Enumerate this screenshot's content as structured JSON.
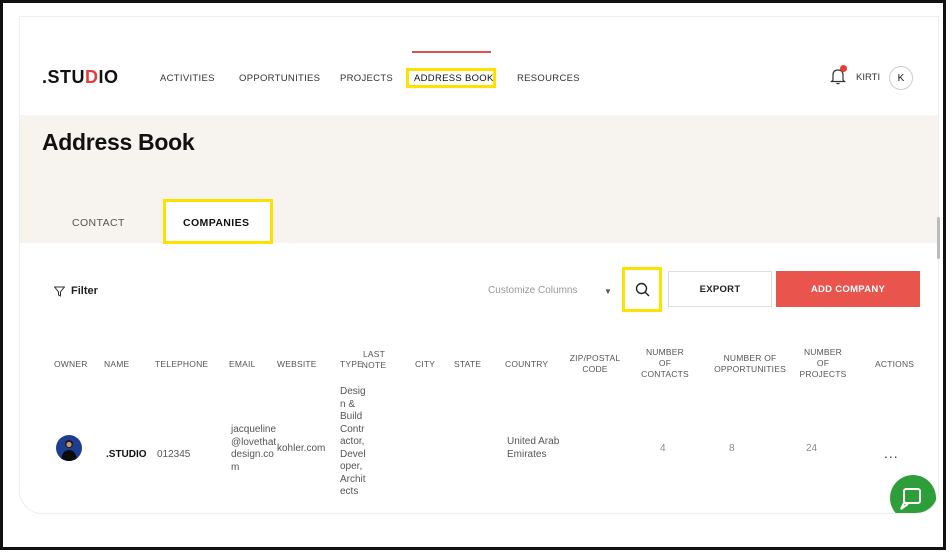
{
  "brand": {
    "logo_prefix": ".STU",
    "logo_mark": "D",
    "logo_suffix": "IO",
    "accent": "#e63b3b"
  },
  "nav": {
    "items": [
      "ACTIVITIES",
      "OPPORTUNITIES",
      "PROJECTS",
      "ADDRESS BOOK",
      "RESOURCES"
    ],
    "active": "ADDRESS BOOK"
  },
  "user": {
    "name": "KIRTI",
    "initial": "K"
  },
  "page": {
    "title": "Address Book"
  },
  "tabs": {
    "contact": "CONTACT",
    "companies": "COMPANIES",
    "active": "COMPANIES"
  },
  "toolbar": {
    "filter_label": "Filter",
    "customize_label": "Customize Columns",
    "export_label": "EXPORT",
    "add_label": "ADD COMPANY",
    "add_color": "#e9544c"
  },
  "table": {
    "headers": {
      "owner": "OWNER",
      "name": "NAME",
      "telephone": "TELEPHONE",
      "email": "EMAIL",
      "website": "WEBSITE",
      "type": "TYPE",
      "last_note_1": "LAST",
      "last_note_2": "NOTE",
      "city": "CITY",
      "state": "STATE",
      "country": "COUNTRY",
      "zip_1": "ZIP/POSTAL",
      "zip_2": "CODE",
      "contacts_1": "NUMBER",
      "contacts_2": "OF",
      "contacts_3": "CONTACTS",
      "opps_1": "NUMBER OF",
      "opps_2": "OPPORTUNITIES",
      "projects_1": "NUMBER",
      "projects_2": "OF",
      "projects_3": "PROJECTS",
      "actions": "ACTIONS"
    },
    "rows": [
      {
        "name": ".STUDIO",
        "telephone": "012345",
        "email_lines": [
          "jacqueline",
          "@lovethat",
          "design.co",
          "m"
        ],
        "website": "kohler.com",
        "type_lines": [
          "Desig",
          "n &",
          "Build",
          "Contr",
          "actor,",
          "Devel",
          "oper,",
          "Archit",
          "ects"
        ],
        "country_lines": [
          "United Arab",
          "Emirates"
        ],
        "contacts": "4",
        "opportunities": "8",
        "projects": "24",
        "actions": "..."
      }
    ]
  }
}
